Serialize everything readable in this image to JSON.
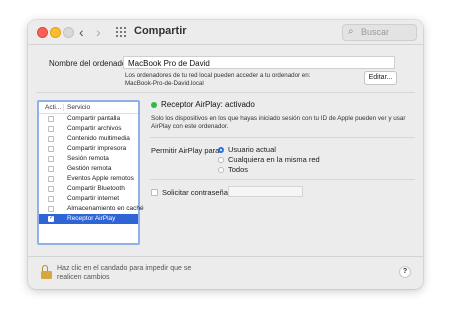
{
  "window": {
    "title": "Compartir",
    "search_placeholder": "Buscar"
  },
  "icons": {
    "back": "‹",
    "forward": "›",
    "search": "⌕",
    "help": "?"
  },
  "computer": {
    "label": "Nombre del ordenador:",
    "name": "MacBook Pro de David",
    "description_line1": "Los ordenadores de tu red local pueden acceder a tu ordenador en:",
    "description_line2": "MacBook-Pro-de-David.local",
    "edit_button": "Editar..."
  },
  "services": {
    "header_on": "Acti...",
    "header_service": "Servicio",
    "items": [
      {
        "name": "Compartir pantalla",
        "on": false,
        "selected": false
      },
      {
        "name": "Compartir archivos",
        "on": false,
        "selected": false
      },
      {
        "name": "Contenido multimedia",
        "on": false,
        "selected": false
      },
      {
        "name": "Compartir impresora",
        "on": false,
        "selected": false
      },
      {
        "name": "Sesión remota",
        "on": false,
        "selected": false
      },
      {
        "name": "Gestión remota",
        "on": false,
        "selected": false
      },
      {
        "name": "Eventos Apple remotos",
        "on": false,
        "selected": false
      },
      {
        "name": "Compartir Bluetooth",
        "on": false,
        "selected": false
      },
      {
        "name": "Compartir internet",
        "on": false,
        "selected": false
      },
      {
        "name": "Almacenamiento en caché",
        "on": false,
        "selected": false
      },
      {
        "name": "Receptor AirPlay",
        "on": true,
        "selected": true
      }
    ]
  },
  "detail": {
    "status": "Receptor AirPlay: activado",
    "status_color": "#31b945",
    "description": "Solo los dispositivos en los que hayas iniciado sesión con tu ID de Apple pueden ver y usar AirPlay con este ordenador.",
    "share_label": "Permitir AirPlay para:",
    "options": [
      {
        "label": "Usuario actual",
        "selected": true
      },
      {
        "label": "Cualquiera en la misma red",
        "selected": false
      },
      {
        "label": "Todos",
        "selected": false
      }
    ],
    "password_label": "Solicitar contraseña"
  },
  "footer": {
    "lock_text": "Haz clic en el candado para impedir que se realicen cambios"
  },
  "colors": {
    "accent": "#2f64d6",
    "selection_border": "#8fb1e8"
  }
}
